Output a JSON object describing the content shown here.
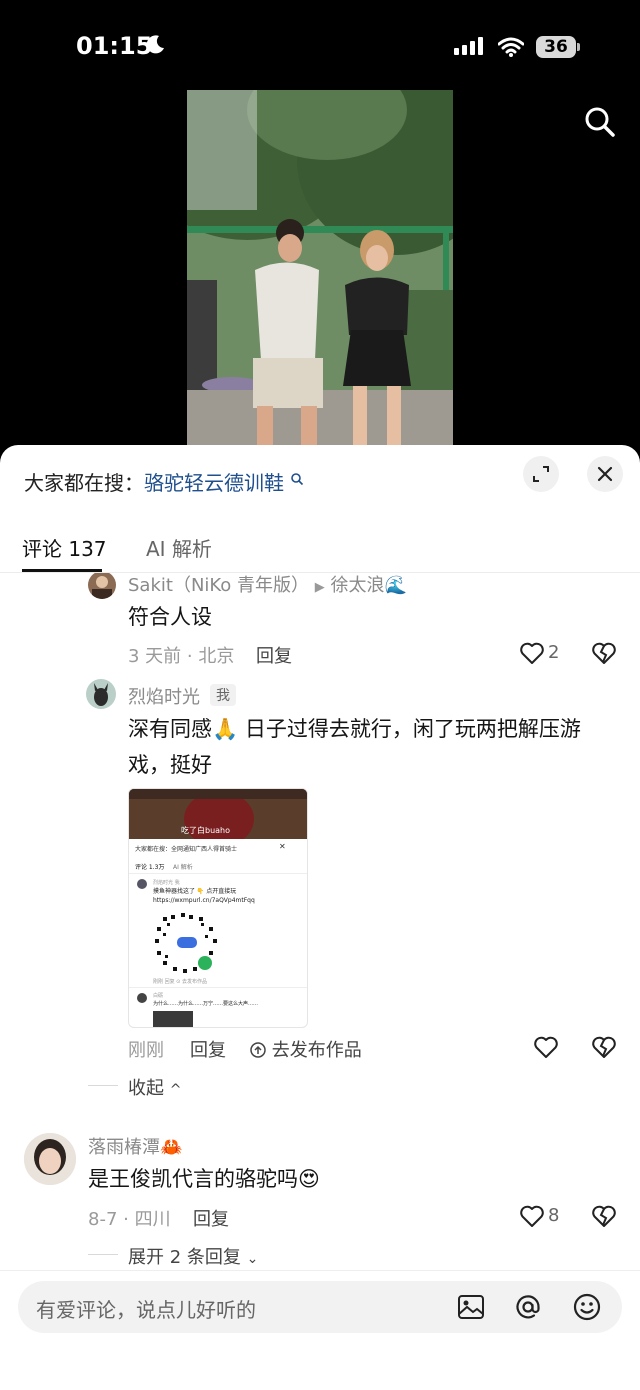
{
  "status_bar": {
    "time": "01:15",
    "battery": "36"
  },
  "sheet": {
    "search_prefix": "大家都在搜：",
    "search_keyword": "骆驼轻云德训鞋",
    "tabs": [
      {
        "label": "评论 137",
        "active": true
      },
      {
        "label": "AI 解析",
        "active": false
      }
    ]
  },
  "comments": [
    {
      "user": "Sakit（NiKo 青年版）",
      "reply_to": "徐太浪🌊",
      "text": "符合人设",
      "meta": "3 天前 · 北京",
      "reply_label": "回复",
      "likes": "2"
    },
    {
      "user": "烈焰时光",
      "badge": "我",
      "text": "深有同感🙏 日子过得去就行，闲了玩两把解压游戏，挺好",
      "meta": "刚刚",
      "reply_label": "回复",
      "publish_label": "去发布作品",
      "collapse_label": "收起",
      "attachment": {
        "video_caption": "吃了白buaho",
        "search_line": "大家都在搜：全网通知广西人得首骑士",
        "tab_comments": "评论 1.3万",
        "tab_ai": "AI 解析",
        "user": "烈焰时光 我",
        "text": "摸鱼神器找这了 👇 点开直接玩 https://wxmpurl.cn/7aQVp4mtFqq",
        "meta": "刚刚  回复  ⊙ 去发布作品",
        "user2": "白砺",
        "text2": "为什么……为什么……万宁……要这么大声……"
      }
    },
    {
      "user": "落雨椿潭🦀",
      "text": "是王俊凯代言的骆驼吗😍",
      "meta": "8-7 · 四川",
      "reply_label": "回复",
      "likes": "8",
      "expand_label": "展开 2 条回复"
    }
  ],
  "input": {
    "placeholder": "有爱评论，说点儿好听的"
  },
  "colors": {
    "keyword": "#1f4f8c",
    "sheet_bg": "#ffffff",
    "text_muted": "#8a8a8a"
  }
}
